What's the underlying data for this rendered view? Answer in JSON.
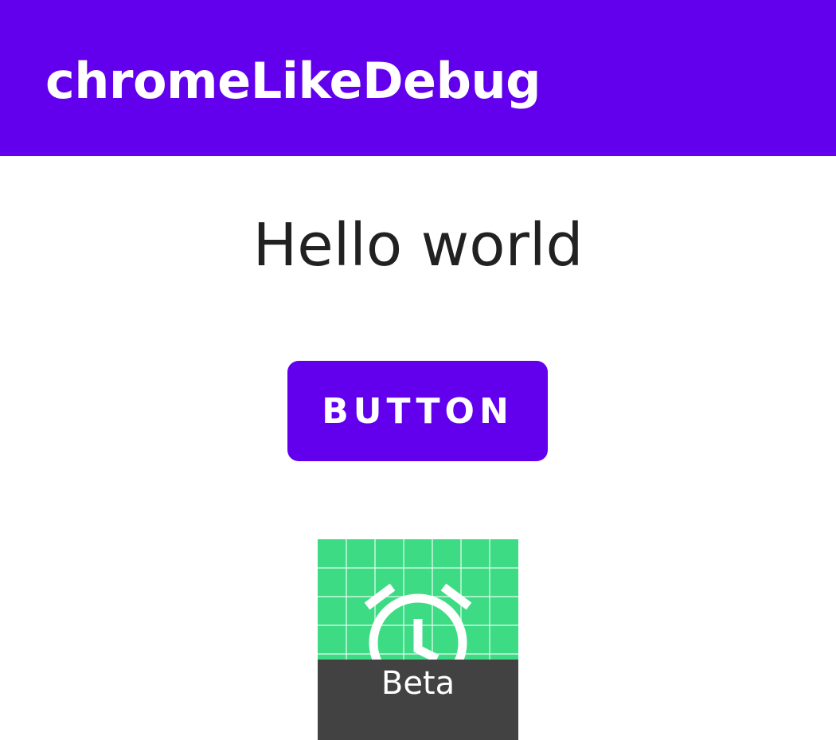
{
  "app_bar": {
    "title": "chromeLikeDebug",
    "color": "#6200ee"
  },
  "main": {
    "greeting": "Hello world",
    "button_label": "BUTTON"
  },
  "app_icon": {
    "icon": "alarm-clock-icon",
    "badge_label": "Beta",
    "background_color": "#3ddc84",
    "badge_color": "#424242"
  }
}
